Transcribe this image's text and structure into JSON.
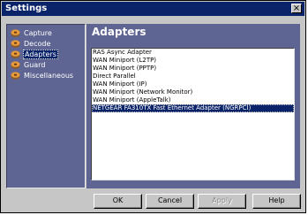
{
  "window": {
    "title": "Settings",
    "close_glyph": "×"
  },
  "nav": {
    "items": [
      {
        "label": "Capture",
        "icon": "disk-icon",
        "selected": false
      },
      {
        "label": "Decode",
        "icon": "disk-icon",
        "selected": false
      },
      {
        "label": "Adapters",
        "icon": "disk-icon",
        "selected": true
      },
      {
        "label": "Guard",
        "icon": "disk-icon",
        "selected": false
      },
      {
        "label": "Miscellaneous",
        "icon": "disk-icon",
        "selected": false
      }
    ]
  },
  "panel": {
    "title": "Adapters"
  },
  "adapters": {
    "items": [
      "RAS Async Adapter",
      "WAN Miniport (L2TP)",
      "WAN Miniport (PPTP)",
      "Direct Parallel",
      "WAN Miniport (IP)",
      "WAN Miniport (Network Monitor)",
      "WAN Miniport (AppleTalk)",
      "NETGEAR FA310TX Fast Ethernet Adapter (NGRPCI)"
    ],
    "selected_index": 7
  },
  "buttons": {
    "ok": "OK",
    "cancel": "Cancel",
    "apply": "Apply",
    "help": "Help"
  },
  "colors": {
    "titlebar": "#0a2369",
    "panel": "#5f6592",
    "face": "#c6c6c6"
  }
}
